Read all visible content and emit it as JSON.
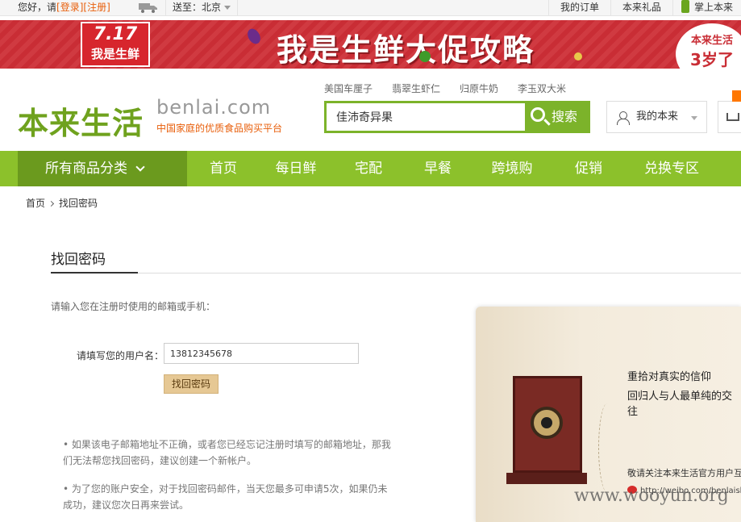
{
  "topbar": {
    "greeting": "您好，请",
    "login": "[登录]",
    "register": "[注册]",
    "ship_to": "送至：北京",
    "my_orders": "我的订单",
    "gifts": "本来礼品",
    "mobile": "掌上本来"
  },
  "banner": {
    "badge_date": "7.17",
    "badge_text": "我是生鲜",
    "headline": "我是生鲜大促攻略",
    "anniv_line1": "本来生活",
    "anniv_line2": "3岁了"
  },
  "logo": {
    "cn": "本来生活",
    "en": "benlai.com",
    "slogan": "中国家庭的优质食品购买平台"
  },
  "hot_searches": [
    "美国车厘子",
    "翡翠生虾仁",
    "归原牛奶",
    "李玉双大米"
  ],
  "search": {
    "value": "佳沛奇异果",
    "button": "搜索"
  },
  "account": {
    "label": "我的本来"
  },
  "nav": {
    "all_categories": "所有商品分类",
    "items": [
      "首页",
      "每日鲜",
      "宅配",
      "早餐",
      "跨境购",
      "促销",
      "兑换专区"
    ]
  },
  "breadcrumb": {
    "home": "首页",
    "current": "找回密码"
  },
  "form": {
    "title": "找回密码",
    "instruction": "请输入您在注册时使用的邮箱或手机：",
    "username_label": "请填写您的用户名：",
    "username_value": "13812345678",
    "submit": "找回密码"
  },
  "notes": [
    "• 如果该电子邮箱地址不正确，或者您已经忘记注册时填写的邮箱地址，那我们无法帮您找回密码，建议创建一个新帐户。",
    "• 为了您的账户安全，对于找回密码邮件，当天您最多可申请5次，如果仍未成功，建议您次日再来尝试。"
  ],
  "promo": {
    "line1": "重拾对真实的信仰",
    "line2": "回归人与人最单纯的交往",
    "follow": "敬请关注本来生活官方用户互动微",
    "weibo": "http://weibo.com/benlaishengh"
  },
  "watermark": "www.wooyun.org",
  "colors": {
    "brand_green": "#8cc12b",
    "nav_dark_green": "#6b9a1e",
    "accent_orange": "#e85e0a",
    "banner_red": "#c92d35"
  }
}
